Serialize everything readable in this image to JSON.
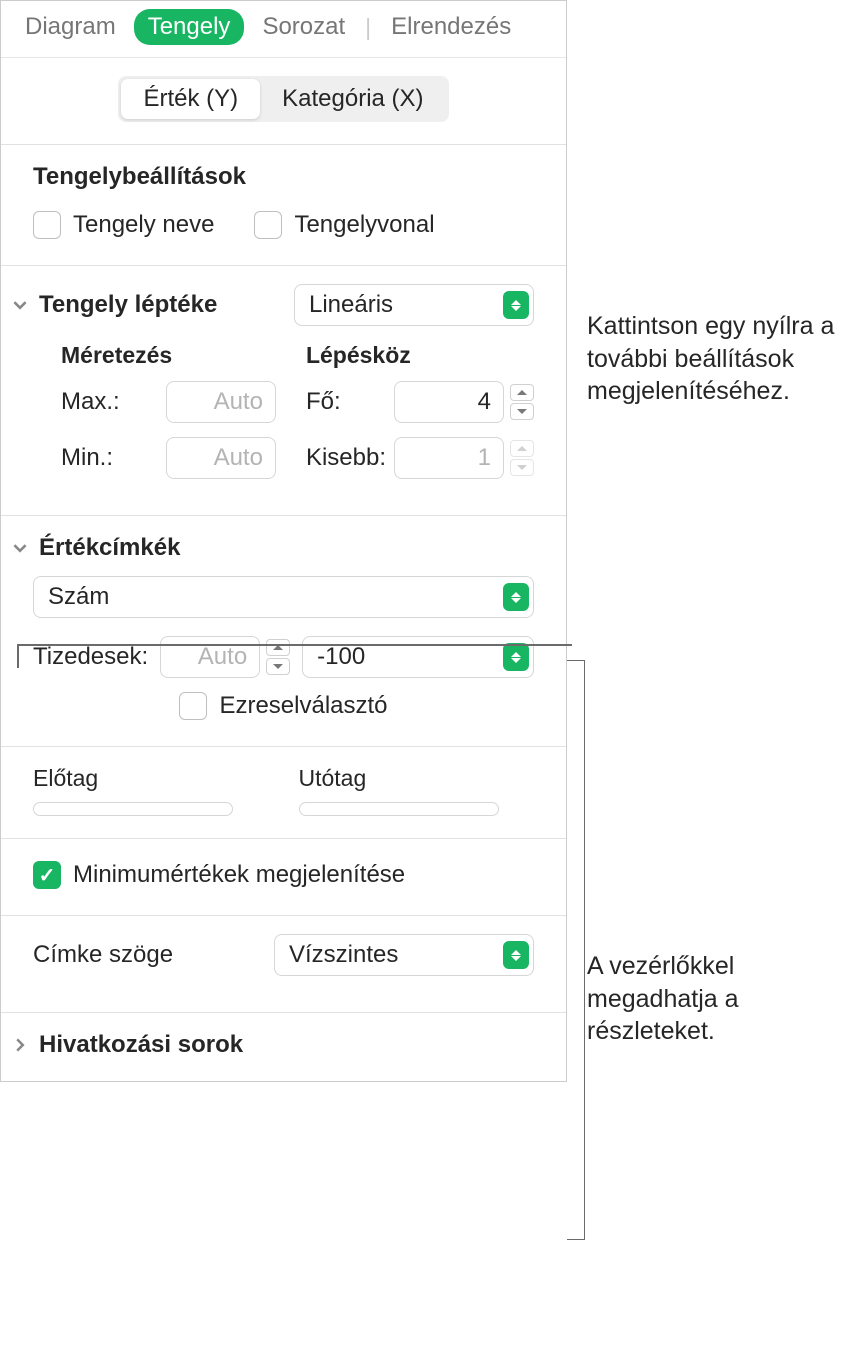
{
  "tabs": {
    "diagram": "Diagram",
    "axis": "Tengely",
    "series": "Sorozat",
    "layout": "Elrendezés"
  },
  "segmented": {
    "valueY": "Érték (Y)",
    "categoryX": "Kategória (X)"
  },
  "axisOptions": {
    "title": "Tengelybeállítások",
    "axisName": "Tengely neve",
    "axisLine": "Tengelyvonal"
  },
  "scale": {
    "title": "Tengely léptéke",
    "type": "Lineáris",
    "scaling": "Méretezés",
    "step": "Lépésköz",
    "maxLabel": "Max.:",
    "maxValue": "Auto",
    "minLabel": "Min.:",
    "minValue": "Auto",
    "majorLabel": "Fő:",
    "majorValue": "4",
    "minorLabel": "Kisebb:",
    "minorValue": "1"
  },
  "valueLabels": {
    "title": "Értékcímkék",
    "format": "Szám",
    "decimalsLabel": "Tizedesek:",
    "decimalsValue": "Auto",
    "negative": "-100",
    "thousandsSeparator": "Ezreselválasztó",
    "prefixLabel": "Előtag",
    "suffixLabel": "Utótag",
    "showMinimum": "Minimumértékek megjelenítése"
  },
  "labelAngle": {
    "label": "Címke szöge",
    "value": "Vízszintes"
  },
  "refLines": {
    "title": "Hivatkozási sorok"
  },
  "annotations": {
    "ann1": "Kattintson egy nyílra a további beállítások megjelenítéséhez.",
    "ann2": "A vezérlőkkel megadhatja a részleteket."
  }
}
